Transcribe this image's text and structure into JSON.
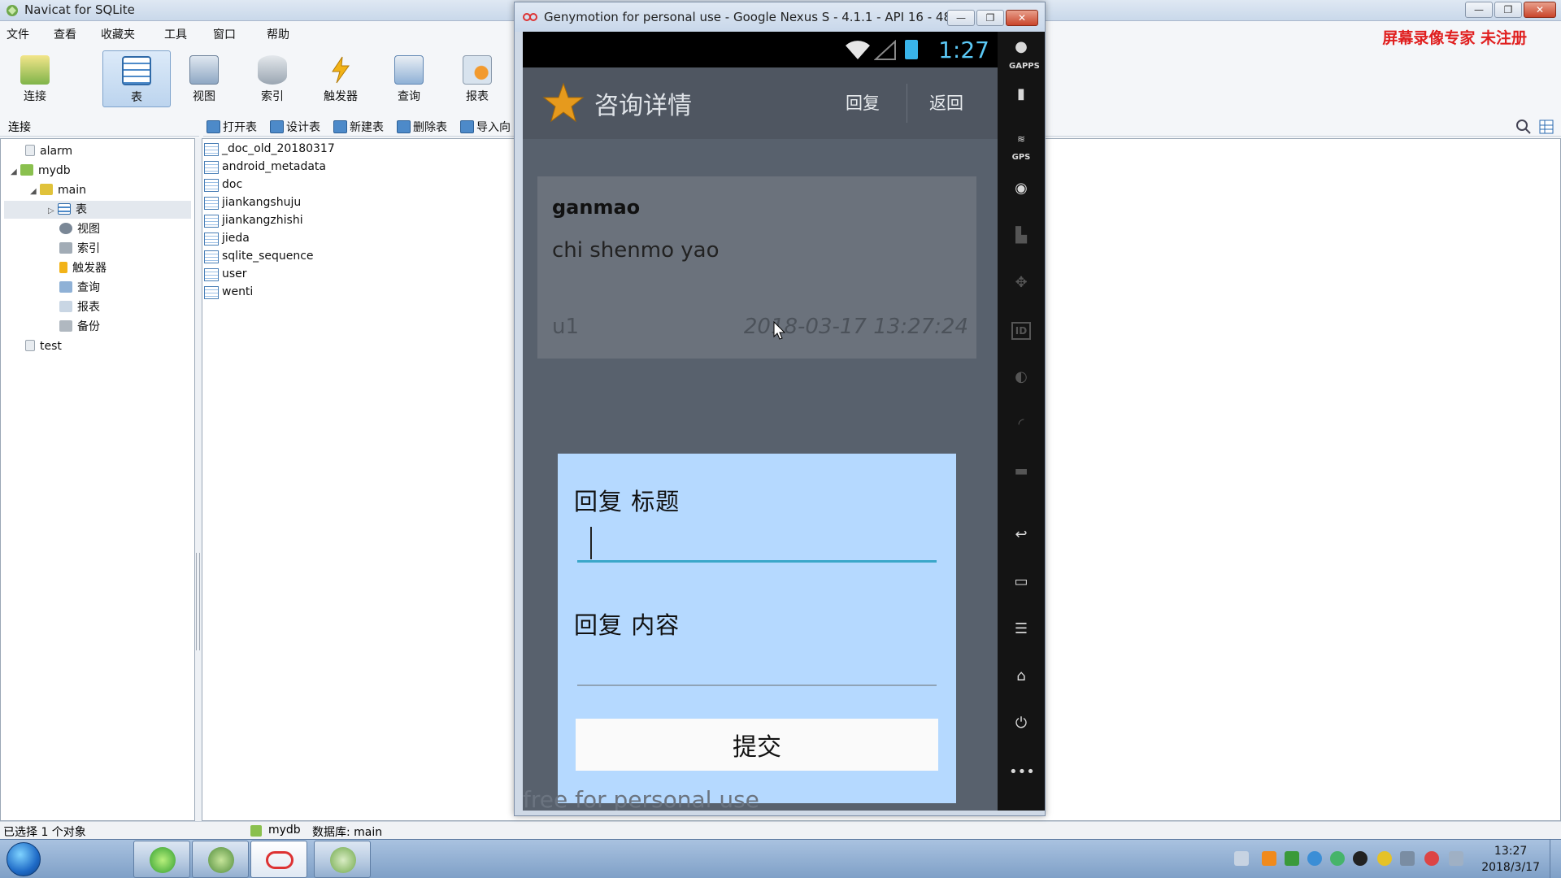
{
  "navicat": {
    "title": "Navicat for SQLite",
    "menu": [
      "文件",
      "查看",
      "收藏夹",
      "工具",
      "窗口",
      "帮助"
    ],
    "toolbar": [
      {
        "label": "连接",
        "icon": "connect-icon"
      },
      {
        "label": "表",
        "icon": "table-icon",
        "active": true
      },
      {
        "label": "视图",
        "icon": "view-icon"
      },
      {
        "label": "索引",
        "icon": "index-icon"
      },
      {
        "label": "触发器",
        "icon": "trigger-icon"
      },
      {
        "label": "查询",
        "icon": "query-icon"
      },
      {
        "label": "报表",
        "icon": "report-icon"
      }
    ],
    "connection_header": "连接",
    "object_toolbar": [
      "打开表",
      "设计表",
      "新建表",
      "删除表",
      "导入向"
    ],
    "tree": {
      "alarm": "alarm",
      "mydb": "mydb",
      "main": "main",
      "children": [
        "表",
        "视图",
        "索引",
        "触发器",
        "查询",
        "报表",
        "备份"
      ],
      "test": "test"
    },
    "tables": [
      "_doc_old_20180317",
      "android_metadata",
      "doc",
      "jiankangshuju",
      "jiankangzhishi",
      "jieda",
      "sqlite_sequence",
      "user",
      "wenti"
    ],
    "status": {
      "selected": "已选择 1 个对象",
      "db_name": "mydb",
      "db_label": "数据库: main"
    }
  },
  "recorder_notice": "屏幕录像专家  未注册",
  "genymotion": {
    "title": "Genymotion for personal use - Google Nexus S - 4.1.1 - API 16 - 48...",
    "status_time": "1:27",
    "app_title": "咨询详情",
    "actions": {
      "reply": "回复",
      "back": "返回"
    },
    "question": {
      "title": "ganmao",
      "body": "chi shenmo yao",
      "user": "u1",
      "time": "2018-03-17 13:27:24"
    },
    "dialog": {
      "title_label": "回复  标题",
      "title_value": "",
      "content_label": "回复  内容",
      "content_value": "",
      "submit": "提交"
    },
    "watermark": "free for personal use",
    "sidebar": {
      "gapps": "GAPPS",
      "gps": "GPS",
      "id": "ID",
      "more": "•••"
    }
  },
  "taskbar": {
    "time": "13:27",
    "date": "2018/3/17"
  },
  "colors": {
    "accent_blue": "#b5d9ff",
    "focus_line": "#3aa7c9",
    "clock_blue": "#5bc8f5",
    "notice_red": "#e02020"
  }
}
